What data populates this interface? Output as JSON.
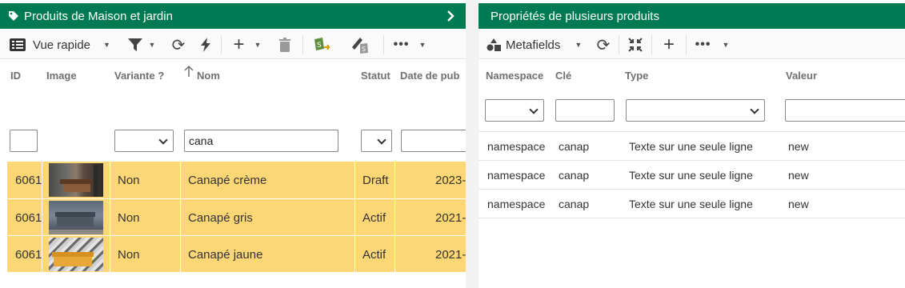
{
  "left": {
    "title": "Produits de Maison et jardin",
    "toolbar": {
      "view_label": "Vue rapide"
    },
    "columns": {
      "id": "ID",
      "image": "Image",
      "variant": "Variante ?",
      "name": "Nom",
      "status": "Statut",
      "date": "Date de pub"
    },
    "filters": {
      "name_value": "cana"
    },
    "rows": [
      {
        "id": "6061",
        "variant": "Non",
        "name": "Canapé crème",
        "status": "Draft",
        "date": "2023-"
      },
      {
        "id": "6061",
        "variant": "Non",
        "name": "Canapé gris",
        "status": "Actif",
        "date": "2021-"
      },
      {
        "id": "6061",
        "variant": "Non",
        "name": "Canapé jaune",
        "status": "Actif",
        "date": "2021-"
      }
    ]
  },
  "right": {
    "title": "Propriétés de plusieurs produits",
    "toolbar": {
      "metafields_label": "Metafields"
    },
    "columns": {
      "namespace": "Namespace",
      "key": "Clé",
      "type": "Type",
      "value": "Valeur"
    },
    "rows": [
      {
        "namespace": "namespace",
        "key": "canap",
        "type": "Texte sur une seule ligne",
        "value": "new"
      },
      {
        "namespace": "namespace",
        "key": "canap",
        "type": "Texte sur une seule ligne",
        "value": "new"
      },
      {
        "namespace": "namespace",
        "key": "canap",
        "type": "Texte sur une seule ligne",
        "value": "new"
      }
    ]
  },
  "colors": {
    "header_green": "#007a53",
    "row_highlight": "#fdd775"
  },
  "icons": [
    "tag-icon",
    "chevron-right-icon",
    "list-icon",
    "filter-icon",
    "refresh-icon",
    "bolt-icon",
    "plus-icon",
    "trash-icon",
    "shopify-export-icon",
    "shopify-edit-icon",
    "more-icon",
    "shapes-icon",
    "compress-icon",
    "sort-up-icon"
  ]
}
